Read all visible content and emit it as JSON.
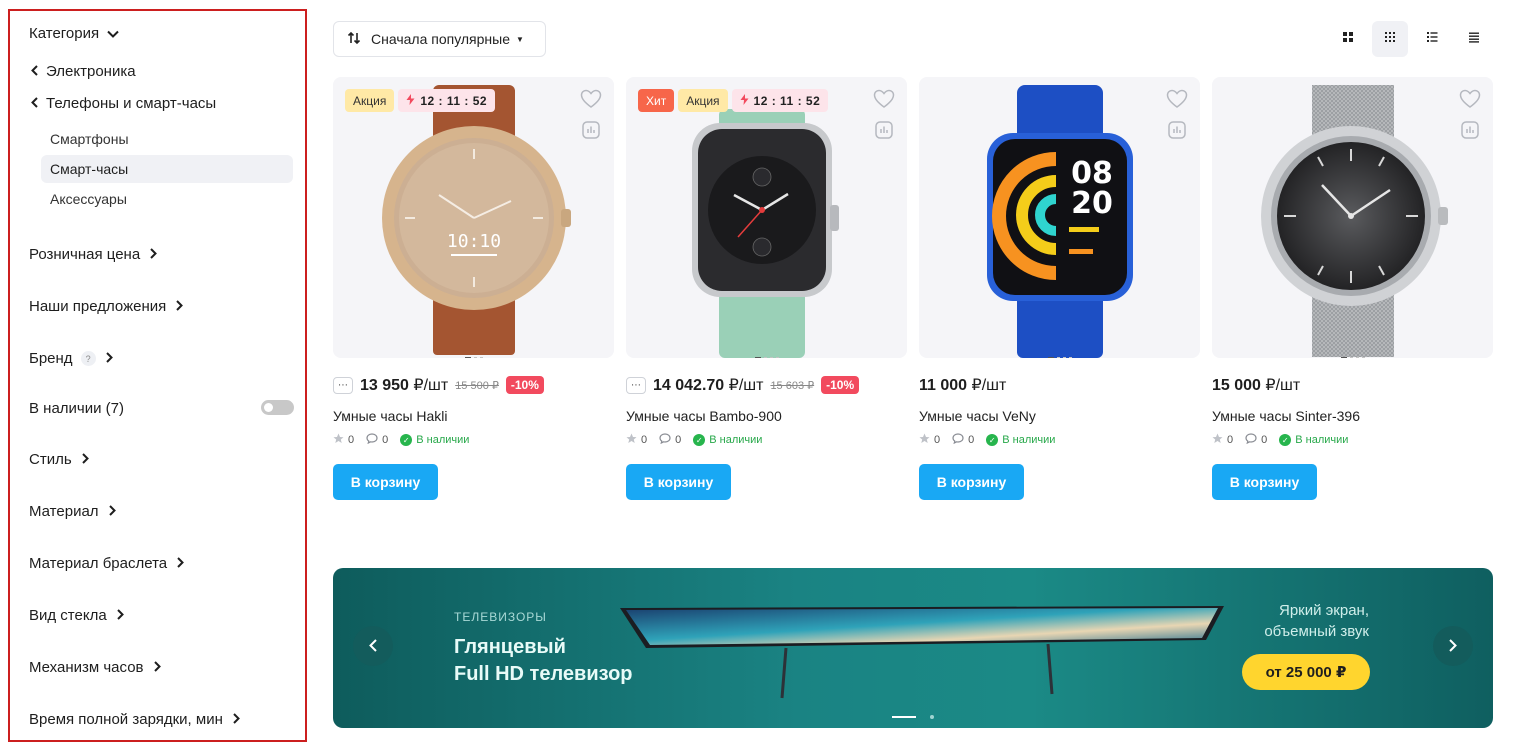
{
  "sidebar": {
    "category_label": "Категория",
    "breadcrumbs": [
      "Электроника",
      "Телефоны и смарт-часы"
    ],
    "subcategories": [
      "Смартфоны",
      "Смарт-часы",
      "Аксессуары"
    ],
    "active_subcategory": "Смарт-часы",
    "filters": {
      "retail_price": "Розничная цена",
      "offers": "Наши предложения",
      "brand": "Бренд",
      "brand_help": "?",
      "in_stock": "В наличии (7)",
      "style": "Стиль",
      "material": "Материал",
      "strap_material": "Материал браслета",
      "glass_type": "Вид стекла",
      "movement": "Механизм часов",
      "charge_time": "Время полной зарядки, мин"
    },
    "in_stock_enabled": false
  },
  "toolbar": {
    "sort_label": "Сначала популярные",
    "views": [
      "grid-large-icon",
      "grid-small-icon",
      "list-icon",
      "compact-list-icon"
    ],
    "active_view": 1
  },
  "products": [
    {
      "name": "Умные часы Hakli",
      "badges": {
        "hit": "",
        "promo": "Акция",
        "timer": "12 : 11 : 52"
      },
      "price": "13 950",
      "unit": "₽/шт",
      "old_price": "15 500 ₽",
      "discount": "-10%",
      "rating": "0",
      "reviews": "0",
      "stock": "В наличии",
      "cart": "В корзину"
    },
    {
      "name": "Умные часы Bambo-900",
      "badges": {
        "hit": "Хит",
        "promo": "Акция",
        "timer": "12 : 11 : 52"
      },
      "price": "14 042.70",
      "unit": "₽/шт",
      "old_price": "15 603 ₽",
      "discount": "-10%",
      "rating": "0",
      "reviews": "0",
      "stock": "В наличии",
      "cart": "В корзину"
    },
    {
      "name": "Умные часы VeNy",
      "badges": {
        "hit": "",
        "promo": "",
        "timer": ""
      },
      "price": "11 000",
      "unit": "₽/шт",
      "old_price": "",
      "discount": "",
      "rating": "0",
      "reviews": "0",
      "stock": "В наличии",
      "cart": "В корзину",
      "screen_time_top": "08",
      "screen_time_bottom": "20"
    },
    {
      "name": "Умные часы Sinter-396",
      "badges": {
        "hit": "",
        "promo": "",
        "timer": ""
      },
      "price": "15 000",
      "unit": "₽/шт",
      "old_price": "",
      "discount": "",
      "rating": "0",
      "reviews": "0",
      "stock": "В наличии",
      "cart": "В корзину"
    }
  ],
  "banner": {
    "category": "ТЕЛЕВИЗОРЫ",
    "title_line1": "Глянцевый",
    "title_line2": "Full HD телевизор",
    "tagline_line1": "Яркий экран,",
    "tagline_line2": "объемный звук",
    "price": "от 25 000 ₽"
  },
  "colors": {
    "accent": "#19a8f4",
    "discount": "#f24a5e",
    "stock_green": "#27a84a",
    "sidebar_border": "#cc1f1f",
    "banner_teal": "#1a8383",
    "banner_price_bg": "#ffd52e"
  }
}
